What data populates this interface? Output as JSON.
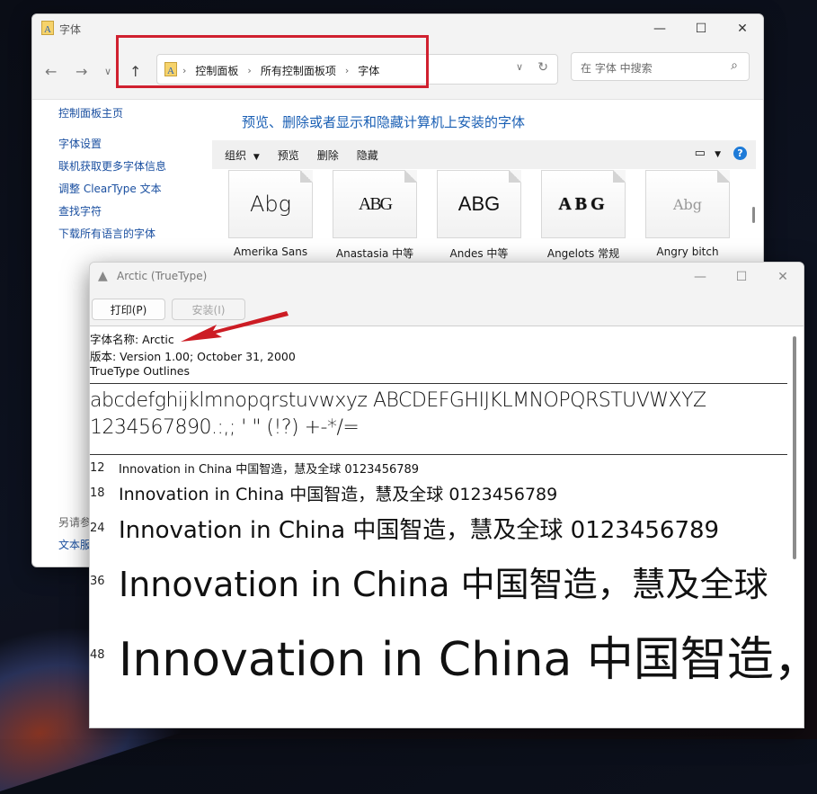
{
  "control_panel": {
    "title": "字体",
    "breadcrumb": [
      "控制面板",
      "所有控制面板项",
      "字体"
    ],
    "search_placeholder": "在 字体 中搜索",
    "sidebar": {
      "home": "控制面板主页",
      "links": [
        "字体设置",
        "联机获取更多字体信息",
        "调整 ClearType 文本",
        "查找字符",
        "下载所有语言的字体"
      ],
      "see_also": "另请参",
      "extra": "文本服"
    },
    "heading": "预览、删除或者显示和隐藏计算机上安装的字体",
    "toolbar": {
      "organize": "组织",
      "preview": "预览",
      "delete": "删除",
      "hide": "隐藏",
      "help": "?"
    },
    "fonts": [
      {
        "glyph": "Abg",
        "name": "Amerika Sans"
      },
      {
        "glyph": "ABG",
        "name": "Anastasia 中等"
      },
      {
        "glyph": "ABG",
        "name": "Andes 中等"
      },
      {
        "glyph": "ABG",
        "name": "Angelots 常规"
      },
      {
        "glyph": "Abg",
        "name": "Angry bitch"
      }
    ]
  },
  "font_viewer": {
    "title": "Arctic (TrueType)",
    "print_button": "打印(P)",
    "install_button": "安装(I)",
    "font_name": "字体名称: Arctic",
    "version": "版本: Version 1.00; October 31, 2000",
    "outline": "TrueType Outlines",
    "charset_line1": "abcdefghijklmnopqrstuvwxyz ABCDEFGHIJKLMNOPQRSTUVWXYZ",
    "charset_line2": "1234567890.:,; ' \" (!?) +-*/=",
    "samples": [
      {
        "size": "12",
        "text": "Innovation in China 中国智造，慧及全球 0123456789"
      },
      {
        "size": "18",
        "text": "Innovation in China 中国智造，慧及全球 0123456789"
      },
      {
        "size": "24",
        "text": "Innovation in China 中国智造，慧及全球 0123456789"
      },
      {
        "size": "36",
        "text": "Innovation in China 中国智造，慧及全球"
      },
      {
        "size": "48",
        "text": "Innovation in China 中国智造，"
      }
    ]
  },
  "colors": {
    "highlight": "#d0202f",
    "link": "#1a4fa0",
    "heading": "#1a5fb4",
    "help": "#1e7bd8"
  }
}
